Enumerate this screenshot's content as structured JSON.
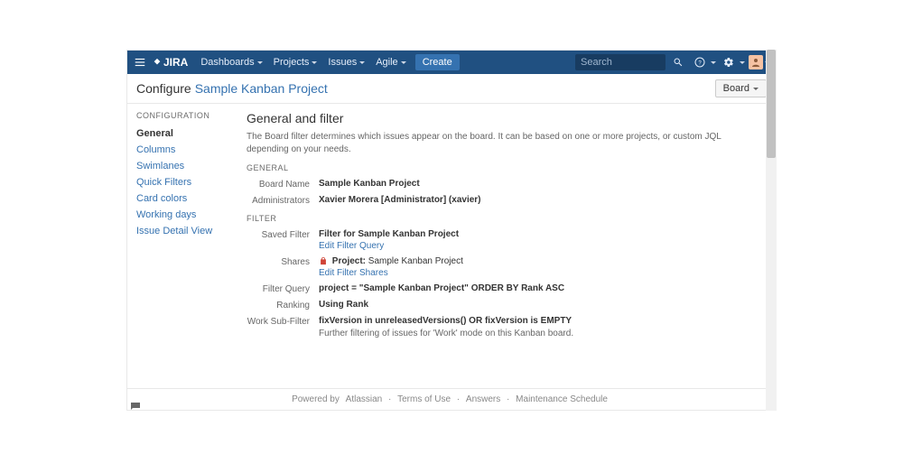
{
  "topnav": {
    "logo": "JIRA",
    "items": [
      "Dashboards",
      "Projects",
      "Issues",
      "Agile"
    ],
    "create": "Create",
    "search_placeholder": "Search"
  },
  "titlebar": {
    "prefix": "Configure",
    "project_link": "Sample Kanban Project",
    "board_button": "Board"
  },
  "sidebar": {
    "heading": "CONFIGURATION",
    "items": [
      {
        "label": "General",
        "active": true
      },
      {
        "label": "Columns",
        "active": false
      },
      {
        "label": "Swimlanes",
        "active": false
      },
      {
        "label": "Quick Filters",
        "active": false
      },
      {
        "label": "Card colors",
        "active": false
      },
      {
        "label": "Working days",
        "active": false
      },
      {
        "label": "Issue Detail View",
        "active": false
      }
    ]
  },
  "main": {
    "heading": "General and filter",
    "description": "The Board filter determines which issues appear on the board. It can be based on one or more projects, or custom JQL depending on your needs.",
    "section_general": "GENERAL",
    "board_name_label": "Board Name",
    "board_name_value": "Sample Kanban Project",
    "admins_label": "Administrators",
    "admins_value": "Xavier Morera [Administrator] (xavier)",
    "section_filter": "FILTER",
    "saved_filter_label": "Saved Filter",
    "saved_filter_value": "Filter for Sample Kanban Project",
    "edit_filter_query": "Edit Filter Query",
    "shares_label": "Shares",
    "shares_project_prefix": "Project:",
    "shares_project_value": "Sample Kanban Project",
    "edit_filter_shares": "Edit Filter Shares",
    "filter_query_label": "Filter Query",
    "filter_query_value": "project = \"Sample Kanban Project\" ORDER BY Rank ASC",
    "ranking_label": "Ranking",
    "ranking_value": "Using Rank",
    "work_subfilter_label": "Work Sub-Filter",
    "work_subfilter_value": "fixVersion in unreleasedVersions() OR fixVersion is EMPTY",
    "work_subfilter_sub": "Further filtering of issues for 'Work' mode on this Kanban board."
  },
  "footer": {
    "powered_prefix": "Powered by",
    "atlassian": "Atlassian",
    "terms": "Terms of Use",
    "answers": "Answers",
    "maintenance": "Maintenance Schedule"
  }
}
